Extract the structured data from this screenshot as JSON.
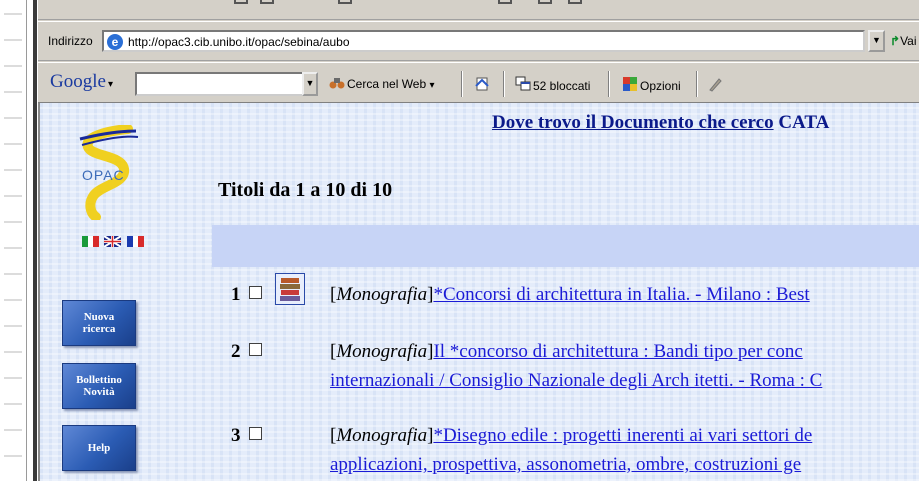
{
  "browser": {
    "address_label": "Indirizzo",
    "url": "http://opac3.cib.unibo.it/opac/sebina/aubo",
    "go_label": "Vai",
    "google_label": "Google",
    "search_value": "",
    "toolbar": {
      "search_web": "Cerca nel Web",
      "blocked": "52 bloccati",
      "options": "Opzioni"
    }
  },
  "sidebar": {
    "logo_text": "OPAC",
    "buttons": [
      {
        "line1": "Nuova",
        "line2": "ricerca"
      },
      {
        "line1": "Bollettino",
        "line2": "Novità"
      },
      {
        "line1": "Help",
        "line2": ""
      }
    ]
  },
  "header": {
    "link": "Dove trovo il Documento che cerco",
    "catalog_fragment": "CATA"
  },
  "results": {
    "heading": "Titoli da 1 a 10 di 10",
    "items": [
      {
        "number": "1",
        "type": "Monografia",
        "line1_link": "*Concorsi di architettura in Italia. - Milano : Best",
        "line2": ""
      },
      {
        "number": "2",
        "type": "Monografia",
        "line1_link": "Il *concorso di architettura : Bandi tipo per conc",
        "line2": "internazionali / Consiglio Nazionale degli Arch itetti. - Roma : C"
      },
      {
        "number": "3",
        "type": "Monografia",
        "line1_link": "*Disegno edile : progetti inerenti ai vari settori de",
        "line2": "applicazioni, prospettiva, assonometria, ombre, costruzioni ge"
      }
    ]
  }
}
